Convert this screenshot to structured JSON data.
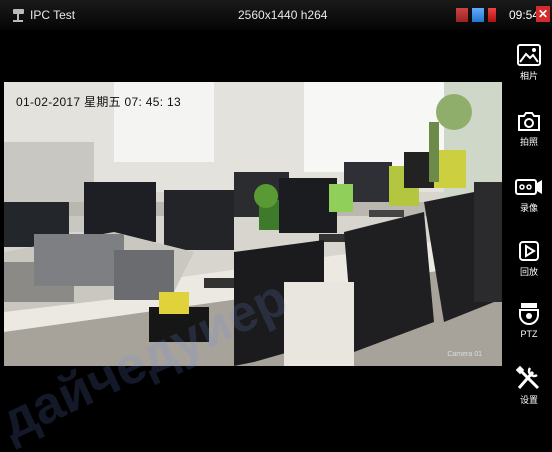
{
  "app": {
    "title": "IPC Test",
    "resolution": "2560x1440 h264",
    "clock": "09:54"
  },
  "osd": {
    "datetime": "01-02-2017 星期五 07: 45: 13",
    "camera_label": "Camera 01"
  },
  "sidebar": {
    "items": [
      {
        "label": "相片",
        "icon": "photo-album-icon"
      },
      {
        "label": "拍照",
        "icon": "camera-icon"
      },
      {
        "label": "录像",
        "icon": "video-record-icon"
      },
      {
        "label": "回放",
        "icon": "playback-icon"
      },
      {
        "label": "PTZ",
        "icon": "ptz-dome-icon"
      },
      {
        "label": "设置",
        "icon": "settings-tools-icon"
      }
    ]
  },
  "watermark": "дайчедуиер"
}
